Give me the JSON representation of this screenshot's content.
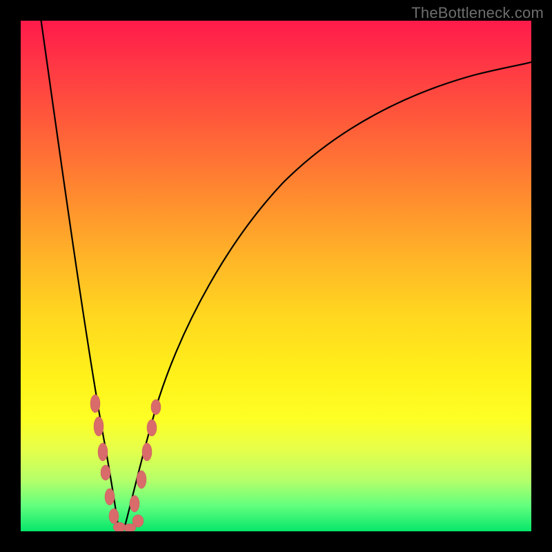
{
  "watermark": {
    "text": "TheBottleneck.com"
  },
  "chart_data": {
    "type": "line",
    "title": "",
    "xlabel": "",
    "ylabel": "",
    "xlim": [
      0,
      100
    ],
    "ylim": [
      0,
      100
    ],
    "grid": false,
    "gradient_stops": [
      {
        "pct": 0,
        "color": "#ff1a4b"
      },
      {
        "pct": 8,
        "color": "#ff3545"
      },
      {
        "pct": 20,
        "color": "#ff5b3a"
      },
      {
        "pct": 34,
        "color": "#ff8a2f"
      },
      {
        "pct": 46,
        "color": "#ffb328"
      },
      {
        "pct": 58,
        "color": "#ffd81f"
      },
      {
        "pct": 70,
        "color": "#fff21a"
      },
      {
        "pct": 78,
        "color": "#fdff25"
      },
      {
        "pct": 84,
        "color": "#e6ff4a"
      },
      {
        "pct": 90,
        "color": "#b5ff6a"
      },
      {
        "pct": 95,
        "color": "#62ff7e"
      },
      {
        "pct": 100,
        "color": "#06e66a"
      }
    ],
    "series": [
      {
        "name": "bottleneck-curve",
        "x": [
          4,
          6,
          8,
          10,
          12,
          14,
          16,
          17,
          18,
          19,
          20,
          21,
          22,
          23,
          25,
          27,
          30,
          35,
          40,
          50,
          60,
          70,
          80,
          90,
          100
        ],
        "y": [
          100,
          86,
          72,
          58,
          44,
          30,
          16,
          9,
          3,
          0,
          2,
          6,
          12,
          18,
          28,
          36,
          46,
          58,
          66,
          76,
          82,
          86,
          88.5,
          90,
          91
        ]
      }
    ],
    "cusp_x": 19,
    "markers": {
      "name": "sample-points",
      "color": "#d96b6b",
      "points": [
        {
          "x": 14.5,
          "y": 26
        },
        {
          "x": 15.5,
          "y": 20
        },
        {
          "x": 16.2,
          "y": 14
        },
        {
          "x": 16.8,
          "y": 10
        },
        {
          "x": 17.6,
          "y": 5
        },
        {
          "x": 18.4,
          "y": 2
        },
        {
          "x": 19.2,
          "y": 0.5
        },
        {
          "x": 20.0,
          "y": 2
        },
        {
          "x": 21.0,
          "y": 6
        },
        {
          "x": 22.2,
          "y": 12
        },
        {
          "x": 23.2,
          "y": 18
        },
        {
          "x": 24.2,
          "y": 22
        },
        {
          "x": 25.0,
          "y": 26
        }
      ]
    }
  }
}
